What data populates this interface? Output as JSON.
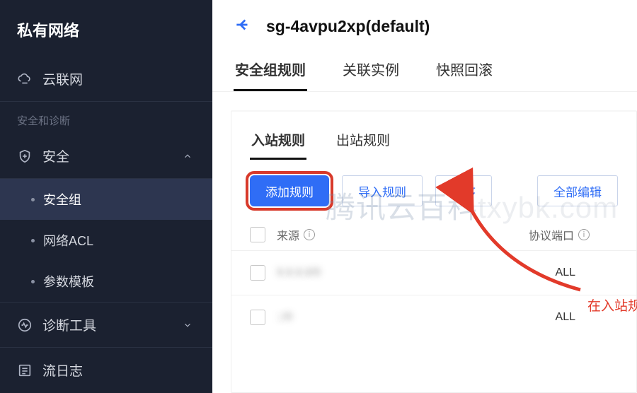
{
  "sidebar": {
    "title": "私有网络",
    "cloud_network": "云联网",
    "section_security": "安全和诊断",
    "security": "安全",
    "sub": {
      "security_group": "安全组",
      "network_acl": "网络ACL",
      "param_template": "参数模板"
    },
    "diagnostic": "诊断工具",
    "flow_log": "流日志"
  },
  "header": {
    "title": "sg-4avpu2xp(default)"
  },
  "tabs1": {
    "rules": "安全组规则",
    "instances": "关联实例",
    "snapshot": "快照回滚"
  },
  "tabs2": {
    "inbound": "入站规则",
    "outbound": "出站规则"
  },
  "actions": {
    "add": "添加规则",
    "import": "导入规则",
    "sort": "排序",
    "edit_all": "全部编辑"
  },
  "table": {
    "th_source": "来源",
    "th_proto": "协议端口",
    "rows": [
      {
        "source": "0.0.0.0/0",
        "proto": "ALL"
      },
      {
        "source": "::/0",
        "proto": "ALL"
      }
    ]
  },
  "annotation": "在入站规则中点击\"添加规则\"",
  "watermark_a": "腾讯云百科",
  "watermark_b": "txybk.com"
}
